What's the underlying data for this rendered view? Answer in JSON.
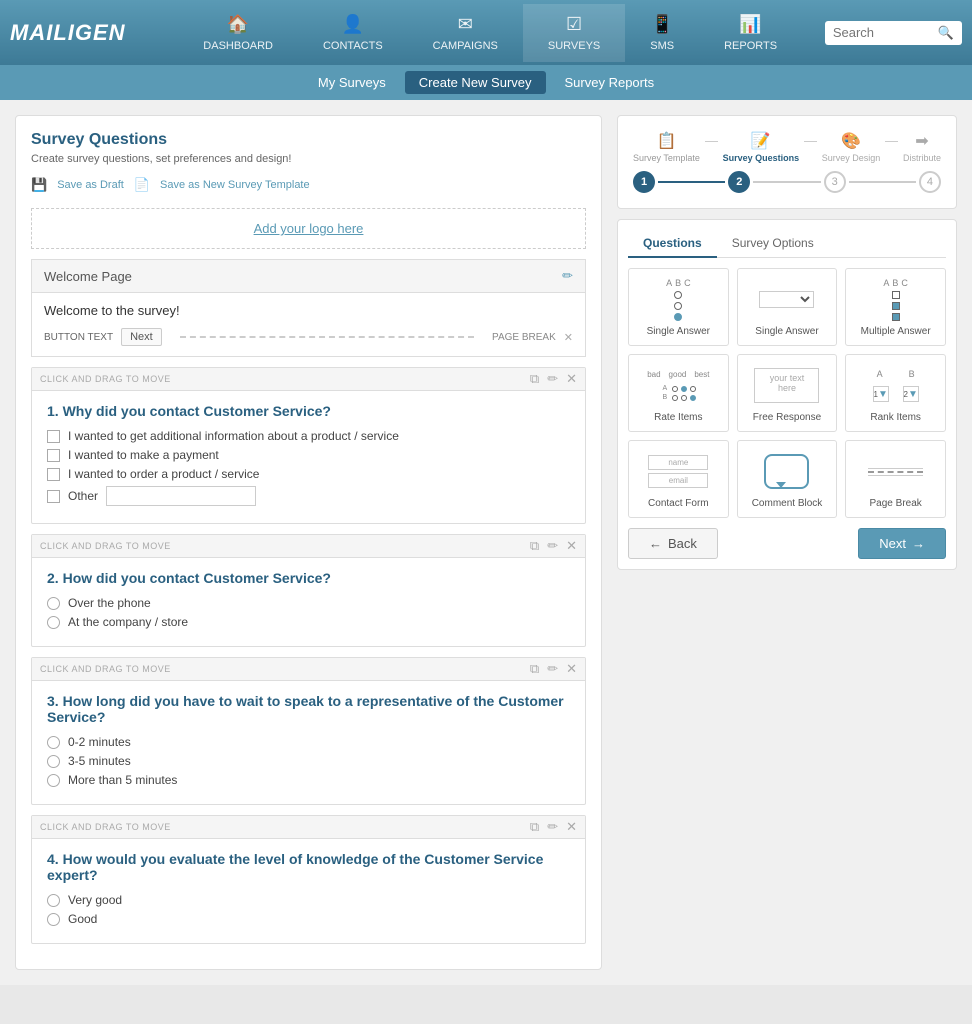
{
  "app": {
    "logo": "MAILIGEN"
  },
  "topnav": {
    "items": [
      {
        "id": "dashboard",
        "label": "DASHBOARD",
        "icon": "🏠"
      },
      {
        "id": "contacts",
        "label": "CONTACTS",
        "icon": "👤"
      },
      {
        "id": "campaigns",
        "label": "CAMPAIGNS",
        "icon": "✉"
      },
      {
        "id": "surveys",
        "label": "SURVEYS",
        "icon": "☑"
      },
      {
        "id": "sms",
        "label": "SMS",
        "icon": "📱"
      },
      {
        "id": "reports",
        "label": "REPORTS",
        "icon": "📊"
      }
    ],
    "search_placeholder": "Search"
  },
  "subnav": {
    "items": [
      {
        "id": "my-surveys",
        "label": "My Surveys",
        "active": false
      },
      {
        "id": "create-survey",
        "label": "Create New Survey",
        "active": true
      },
      {
        "id": "survey-reports",
        "label": "Survey Reports",
        "active": false
      }
    ]
  },
  "left_panel": {
    "title": "Survey Questions",
    "subtitle": "Create survey questions, set preferences and design!",
    "actions": [
      {
        "id": "save-draft",
        "label": "Save as Draft"
      },
      {
        "id": "save-template",
        "label": "Save as New Survey Template"
      }
    ],
    "logo_placeholder": "Add your logo here",
    "welcome_page": {
      "label": "Welcome Page",
      "text": "Welcome to the survey!",
      "button_text": "Next",
      "page_break_label": "PAGE BREAK"
    },
    "questions": [
      {
        "number": "1",
        "title": "Why did you contact Customer Service?",
        "type": "checkbox",
        "options": [
          "I wanted to get additional information about a product / service",
          "I wanted to make a payment",
          "I wanted to order a product / service",
          "Other"
        ],
        "has_other_input": true
      },
      {
        "number": "2",
        "title": "How did you contact Customer Service?",
        "type": "radio",
        "options": [
          "Over the phone",
          "At the company / store"
        ]
      },
      {
        "number": "3",
        "title": "How long did you have to wait to speak to a representative of the Customer Service?",
        "type": "radio",
        "options": [
          "0-2 minutes",
          "3-5 minutes",
          "More than 5 minutes"
        ]
      },
      {
        "number": "4",
        "title": "How would you evaluate the level of knowledge of the Customer Service expert?",
        "type": "radio",
        "options": [
          "Very good",
          "Good"
        ]
      }
    ]
  },
  "right_panel": {
    "wizard_steps": [
      {
        "number": "1",
        "label": "Survey Template",
        "icon": "📋",
        "state": "completed"
      },
      {
        "number": "2",
        "label": "Survey Questions",
        "icon": "📝",
        "state": "active"
      },
      {
        "number": "3",
        "label": "Survey Design",
        "icon": "🎨",
        "state": "inactive"
      },
      {
        "number": "4",
        "label": "Distribute",
        "icon": "➡",
        "state": "inactive"
      }
    ],
    "tabs": [
      {
        "id": "questions",
        "label": "Questions",
        "active": true
      },
      {
        "id": "survey-options",
        "label": "Survey Options",
        "active": false
      }
    ],
    "question_types": [
      {
        "id": "single-answer-radio",
        "label": "Single Answer",
        "type": "radio-group"
      },
      {
        "id": "single-answer-dropdown",
        "label": "Single Answer",
        "type": "dropdown"
      },
      {
        "id": "multiple-answer",
        "label": "Multiple Answer",
        "type": "checkbox-group"
      },
      {
        "id": "rate-items",
        "label": "Rate Items",
        "type": "rate"
      },
      {
        "id": "free-response",
        "label": "Free Response",
        "type": "text"
      },
      {
        "id": "rank-items",
        "label": "Rank Items",
        "type": "rank"
      },
      {
        "id": "contact-form",
        "label": "Contact Form",
        "type": "contact"
      },
      {
        "id": "comment-block",
        "label": "Comment Block",
        "type": "comment"
      },
      {
        "id": "page-break",
        "label": "Page Break",
        "type": "pagebreak"
      }
    ],
    "buttons": {
      "back": "← Back",
      "next": "Next →"
    }
  }
}
